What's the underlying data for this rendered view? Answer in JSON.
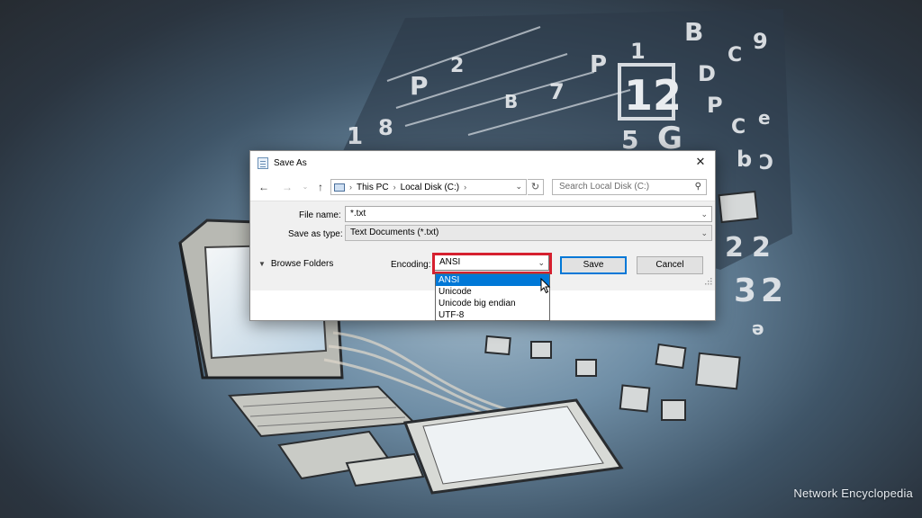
{
  "watermark": "Network Encyclopedia",
  "dialog": {
    "title": "Save As",
    "close_glyph": "✕",
    "nav": {
      "back_icon": "arrow-left-icon",
      "forward_icon": "arrow-right-icon",
      "up_icon": "arrow-up-icon",
      "breadcrumb": [
        "This PC",
        "Local Disk (C:)"
      ],
      "search_placeholder": "Search Local Disk (C:)"
    },
    "file_name": {
      "label": "File name:",
      "value": "*.txt"
    },
    "save_as_type": {
      "label": "Save as type:",
      "value": "Text Documents (*.txt)"
    },
    "browse_folders": "Browse Folders",
    "encoding": {
      "label": "Encoding:",
      "selected": "ANSI",
      "options": [
        "ANSI",
        "Unicode",
        "Unicode big endian",
        "UTF-8"
      ]
    },
    "save_label": "Save",
    "cancel_label": "Cancel"
  },
  "colors": {
    "highlight": "#d6202f",
    "selection": "#0078d7"
  }
}
